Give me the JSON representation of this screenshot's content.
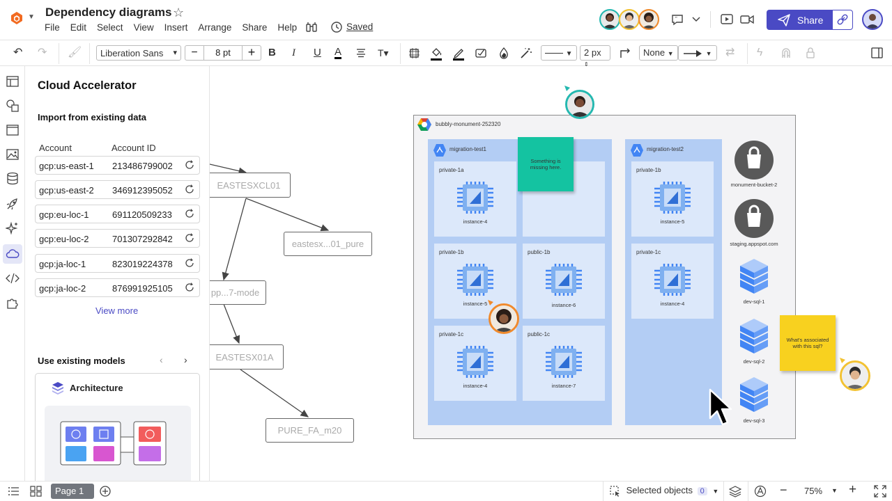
{
  "app": {
    "doc_title": "Dependency diagrams",
    "menu": [
      "File",
      "Edit",
      "Select",
      "View",
      "Insert",
      "Arrange",
      "Share",
      "Help"
    ],
    "saved_label": "Saved",
    "share_label": "Share",
    "accent_color": "#4a4ac4"
  },
  "toolbar": {
    "font": "Liberation Sans",
    "font_size": "8 pt",
    "line_width": "2 px",
    "arrow_start": "None"
  },
  "panel": {
    "title": "Cloud Accelerator",
    "import_title": "Import from existing data",
    "col_account": "Account",
    "col_account_id": "Account ID",
    "accounts": [
      {
        "account": "gcp:us-east-1",
        "id": "213486799002"
      },
      {
        "account": "gcp:us-east-2",
        "id": "346912395052"
      },
      {
        "account": "gcp:eu-loc-1",
        "id": "691120509233"
      },
      {
        "account": "gcp:eu-loc-2",
        "id": "701307292842"
      },
      {
        "account": "gcp:ja-loc-1",
        "id": "823019224378"
      },
      {
        "account": "gcp:ja-loc-2",
        "id": "876991925105"
      }
    ],
    "view_more": "View more",
    "models_title": "Use existing models",
    "model_card_title": "Architecture"
  },
  "canvas": {
    "nodes": [
      "EASTESXCL01",
      "eastesx...01_pure",
      "pp...7-mode",
      "EASTESX01A",
      "PURE_FA_m20"
    ],
    "gcp_project": "bubbly-monument-252320",
    "projects": [
      {
        "name": "migration-test1"
      },
      {
        "name": "migration-test2"
      }
    ],
    "subnets_1": [
      {
        "name": "private-1a",
        "instance": "instance-4"
      },
      {
        "name": "private-1b",
        "instance": "instance-5"
      },
      {
        "name": "public-1b",
        "instance": "instance-6"
      },
      {
        "name": "private-1c",
        "instance": "instance-4"
      },
      {
        "name": "public-1c",
        "instance": "instance-7"
      }
    ],
    "subnets_2": [
      {
        "name": "private-1b",
        "instance": "instance-5"
      },
      {
        "name": "private-1c",
        "instance": "instance-4"
      }
    ],
    "buckets": [
      "monument-bucket-2",
      "staging.appspot.com"
    ],
    "sql": [
      "dev-sql-1",
      "dev-sql-2",
      "dev-sql-3"
    ],
    "sticky_1": "Something is missing here.",
    "sticky_2": "What's associated with this sql?"
  },
  "bottom": {
    "page_label": "Page 1",
    "selected_objects": "Selected objects",
    "selected_count": "0",
    "zoom": "75%"
  }
}
